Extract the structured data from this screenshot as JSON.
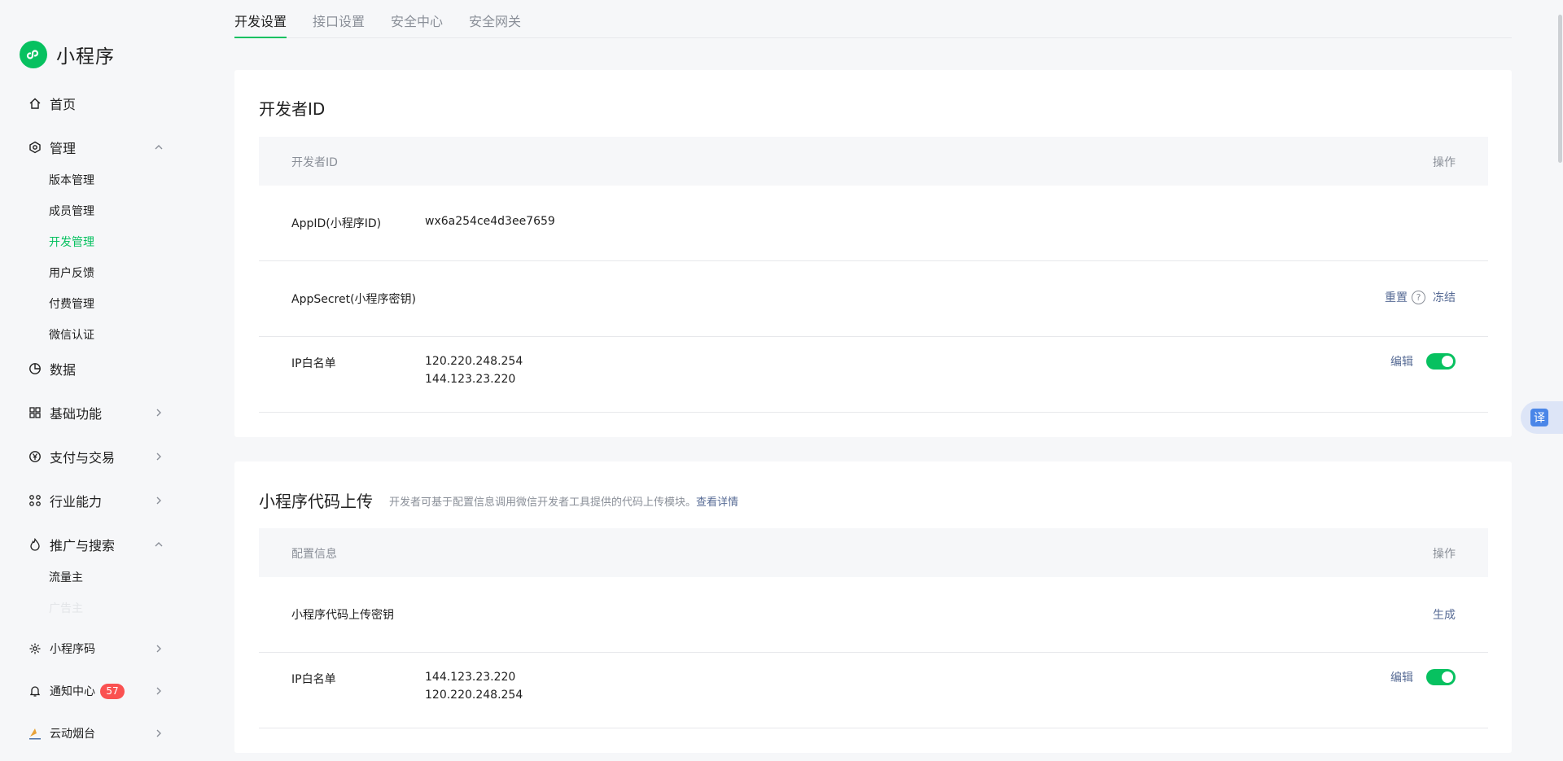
{
  "app": {
    "name": "小程序"
  },
  "sidebar": {
    "home": "首页",
    "manage": {
      "label": "管理",
      "children": [
        "版本管理",
        "成员管理",
        "开发管理",
        "用户反馈",
        "付费管理",
        "微信认证"
      ]
    },
    "data": "数据",
    "basic": "基础功能",
    "pay": "支付与交易",
    "industry": "行业能力",
    "promo": {
      "label": "推广与搜索",
      "children": [
        "流量主",
        "广告主"
      ]
    },
    "qrcode": "小程序码",
    "notify": {
      "label": "通知中心",
      "count": "57"
    },
    "cloud": "云动烟台"
  },
  "tabs": [
    "开发设置",
    "接口设置",
    "安全中心",
    "安全网关"
  ],
  "dev_id_card": {
    "title": "开发者ID",
    "head_left": "开发者ID",
    "head_right": "操作",
    "appid_label": "AppID(小程序ID)",
    "appid_value": "wx6a254ce4d3ee7659",
    "secret_label": "AppSecret(小程序密钥)",
    "reset": "重置",
    "freeze": "冻结",
    "ip_label": "IP白名单",
    "ip_values": [
      "120.220.248.254",
      "144.123.23.220"
    ],
    "edit": "编辑",
    "ip_whitelist_enabled": true
  },
  "upload_card": {
    "title": "小程序代码上传",
    "desc": "开发者可基于配置信息调用微信开发者工具提供的代码上传模块。",
    "desc_link": "查看详情",
    "head_left": "配置信息",
    "head_right": "操作",
    "key_label": "小程序代码上传密钥",
    "generate": "生成",
    "ip_label": "IP白名单",
    "ip_values": [
      "144.123.23.220",
      "120.220.248.254"
    ],
    "edit": "编辑",
    "ip_whitelist_enabled": true
  },
  "translate": "译",
  "colors": {
    "accent": "#07c160",
    "link": "#576b95",
    "badge": "#fa5151"
  }
}
